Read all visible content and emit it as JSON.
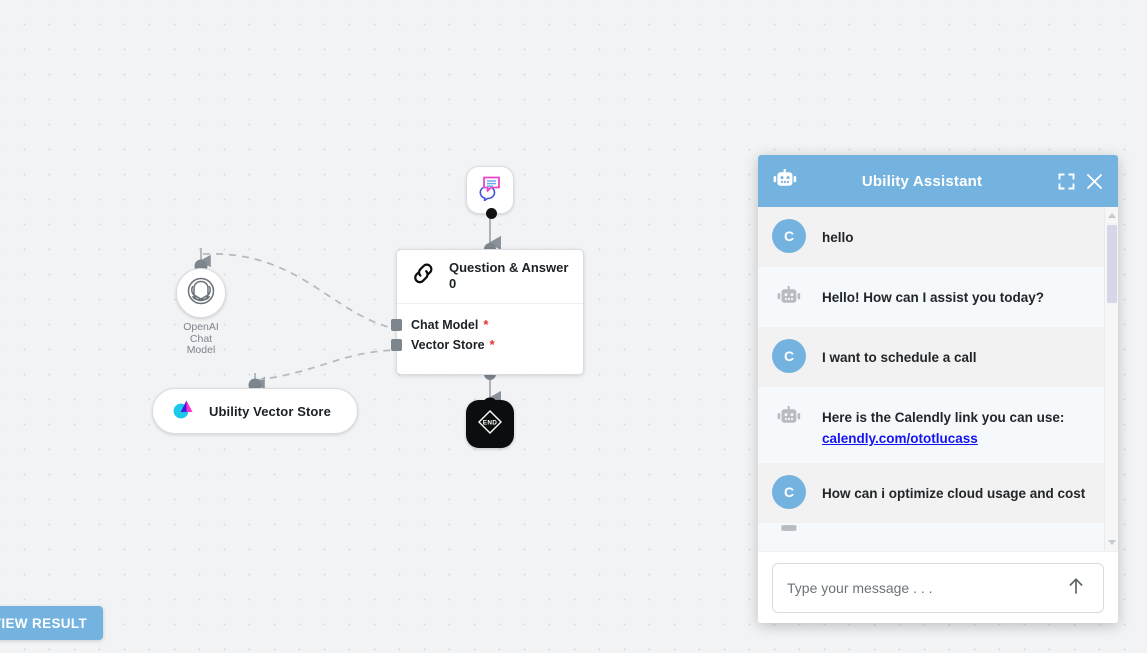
{
  "canvas": {
    "background_color": "#f1f3f5",
    "grid_dot_color": "#d5d9e0"
  },
  "flow": {
    "trigger_node": {
      "icon": "chat-bubbles-icon",
      "name": "chat-trigger-node"
    },
    "openai_node": {
      "icon": "openai-logo-icon",
      "label_line1": "OpenAI",
      "label_line2": "Chat",
      "label_line3": "Model"
    },
    "vector_node": {
      "icon": "ubility-logo-icon",
      "label": "Ubility Vector Store"
    },
    "qa_node": {
      "icon": "chain-link-icon",
      "title": "Question & Answer 0",
      "fields": [
        {
          "label": "Chat Model",
          "required_marker": "*"
        },
        {
          "label": "Vector Store",
          "required_marker": "*"
        }
      ]
    },
    "end_node": {
      "icon": "end-badge-icon",
      "label": "END"
    }
  },
  "toolbar": {
    "view_result_label": "VIEW RESULT",
    "view_result_color": "#74b3e0"
  },
  "chat": {
    "header": {
      "title": "Ubility Assistant",
      "accent_color": "#74b3e0",
      "robot_icon": "robot-icon",
      "expand_icon": "expand-icon",
      "close_icon": "close-icon"
    },
    "messages": [
      {
        "role": "user",
        "avatar": "C",
        "text": "hello"
      },
      {
        "role": "bot",
        "avatar": "robot-icon",
        "text": "Hello! How can I assist you today?"
      },
      {
        "role": "user",
        "avatar": "C",
        "text": "I want to schedule a call"
      },
      {
        "role": "bot",
        "avatar": "robot-icon",
        "text_before_link": "Here is the Calendly link you can use: ",
        "link_text": "calendly.com/ototlucass"
      },
      {
        "role": "user",
        "avatar": "C",
        "text": "How can i optimize cloud usage and cost"
      }
    ],
    "input": {
      "placeholder": "Type your message . . .",
      "value": "",
      "send_icon": "arrow-up-icon"
    },
    "scrollbar": {
      "thumb_color": "#d5d6e8",
      "up_arrow_icon": "caret-up-icon",
      "down_arrow_icon": "caret-down-icon"
    }
  }
}
